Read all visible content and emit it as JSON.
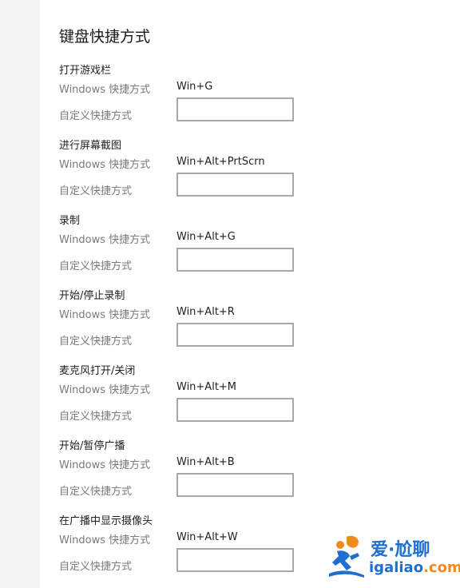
{
  "page": {
    "title": "键盘快捷方式"
  },
  "sections": [
    {
      "title": "打开游戏栏",
      "windows_label": "Windows 快捷方式",
      "windows_shortcut": "Win+G",
      "custom_label": "自定义快捷方式",
      "custom_value": ""
    },
    {
      "title": "进行屏幕截图",
      "windows_label": "Windows 快捷方式",
      "windows_shortcut": "Win+Alt+PrtScrn",
      "custom_label": "自定义快捷方式",
      "custom_value": ""
    },
    {
      "title": "录制",
      "windows_label": "Windows 快捷方式",
      "windows_shortcut": "Win+Alt+G",
      "custom_label": "自定义快捷方式",
      "custom_value": ""
    },
    {
      "title": "开始/停止录制",
      "windows_label": "Windows 快捷方式",
      "windows_shortcut": "Win+Alt+R",
      "custom_label": "自定义快捷方式",
      "custom_value": ""
    },
    {
      "title": "麦克风打开/关闭",
      "windows_label": "Windows 快捷方式",
      "windows_shortcut": "Win+Alt+M",
      "custom_label": "自定义快捷方式",
      "custom_value": ""
    },
    {
      "title": "开始/暂停广播",
      "windows_label": "Windows 快捷方式",
      "windows_shortcut": "Win+Alt+B",
      "custom_label": "自定义快捷方式",
      "custom_value": ""
    },
    {
      "title": "在广播中显示摄像头",
      "windows_label": "Windows 快捷方式",
      "windows_shortcut": "Win+Alt+W",
      "custom_label": "自定义快捷方式",
      "custom_value": ""
    }
  ],
  "watermark": {
    "name": "爱·尬聊",
    "domain_main": "igaliao",
    "domain_suffix": ".com",
    "icon": "running-figure-icon"
  },
  "colors": {
    "title_text": "#1a1a1a",
    "label_text": "#7a7a7a",
    "input_border": "#a8a8a8",
    "side_strip": "#f3f3f3",
    "logo_blue": "#1e6fd1",
    "logo_orange": "#f08a1c"
  }
}
